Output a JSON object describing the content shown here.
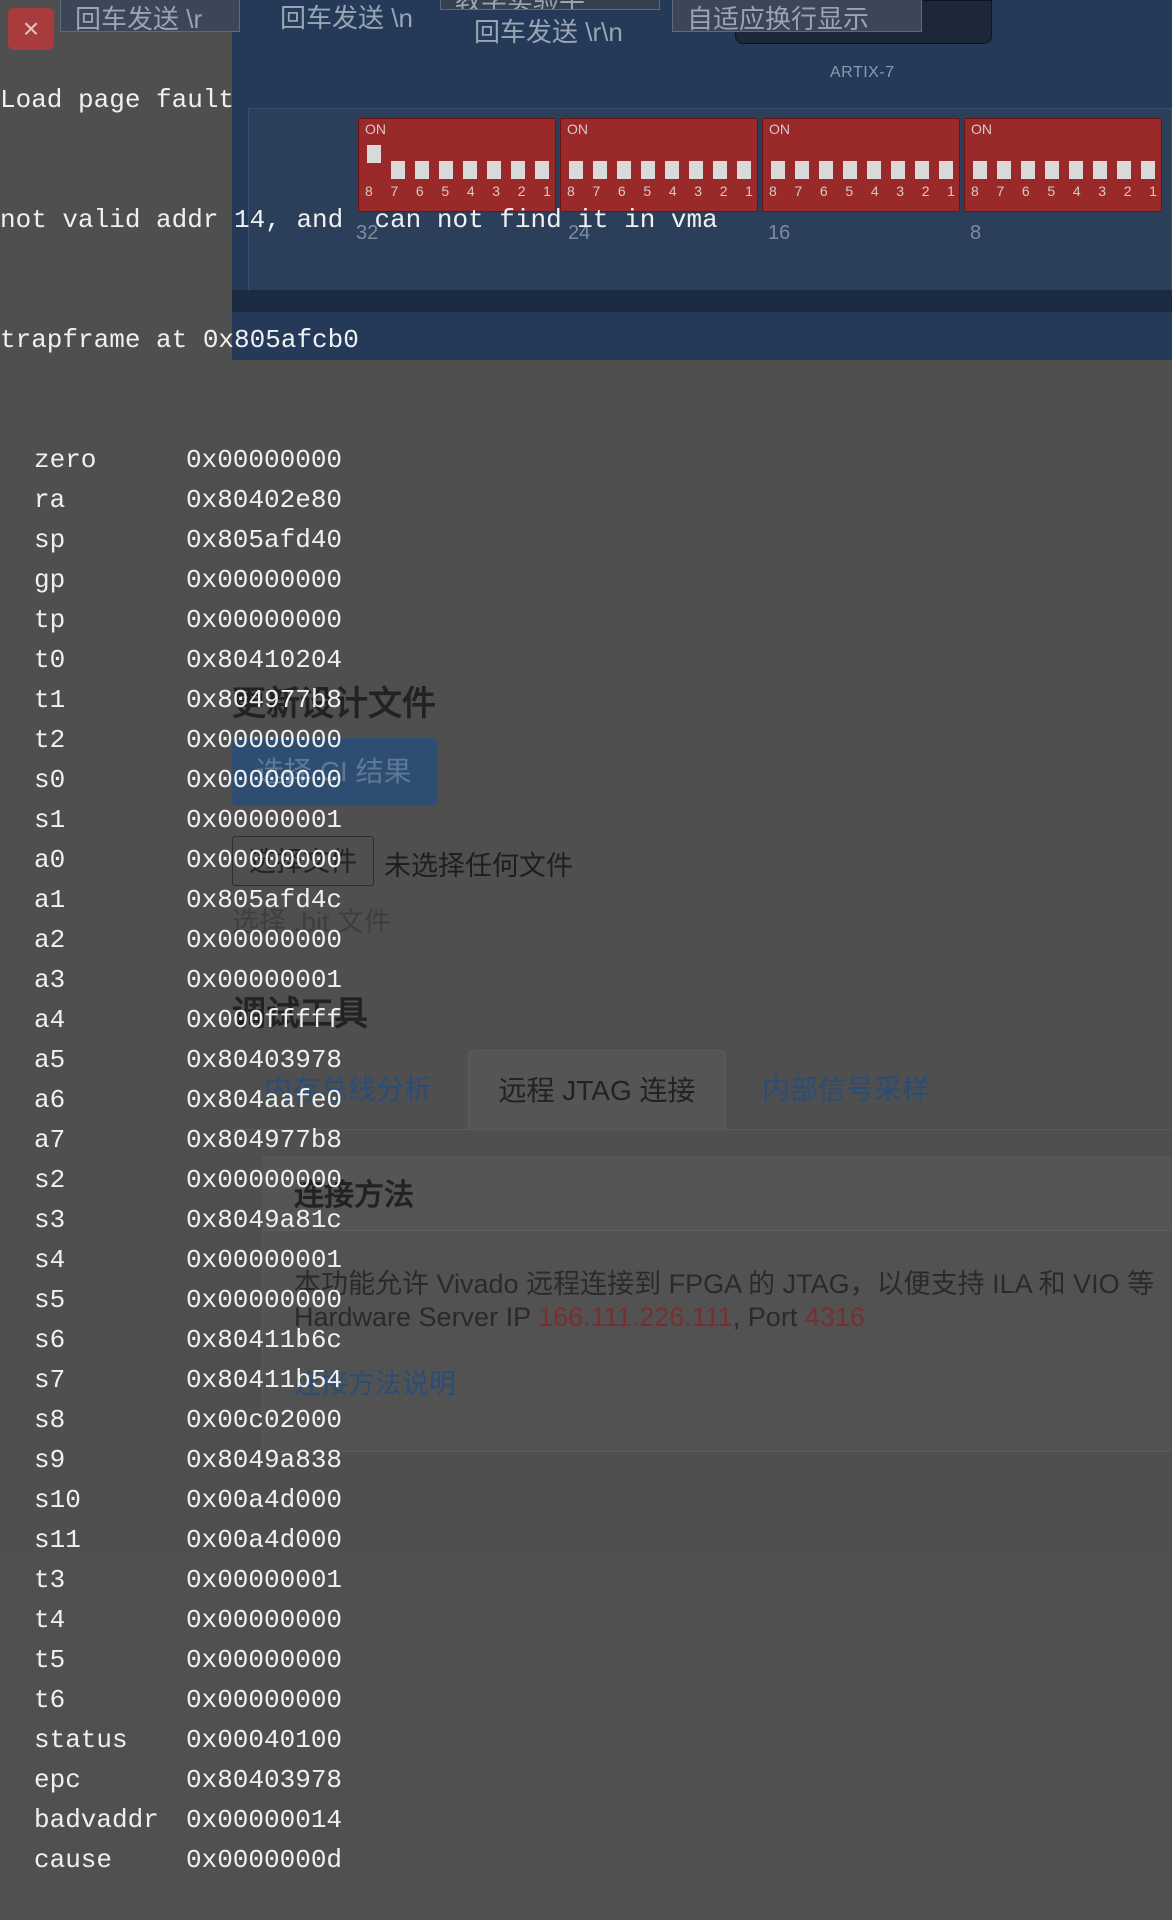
{
  "background": {
    "toolbar_buttons": [
      "回车发送 \\r",
      "回车发送 \\n",
      "回车发送 \\r\\n",
      "自适应换行显示"
    ],
    "toolbar_button_partial": "教学实验平",
    "close_icon": "×",
    "chip_label": "ARTIX-7",
    "dip_on_label": "ON",
    "dip_numbers": [
      "8",
      "7",
      "6",
      "5",
      "4",
      "3",
      "2",
      "1"
    ],
    "dip_indices": [
      "32",
      "24",
      "16",
      "8"
    ],
    "update_heading": "更新设计文件",
    "select_ci_button": "选择 CI 结果",
    "choose_file_button": "选择文件",
    "no_file_chosen": "未选择任何文件",
    "file_hint": "选择 .bit 文件",
    "debug_heading": "调试工具",
    "tabs": [
      "内存总线分析",
      "远程 JTAG 连接",
      "内部信号采样"
    ],
    "connect_heading": "连接方法",
    "connect_desc": "本功能允许 Vivado 远程连接到 FPGA 的 JTAG，以便支持 ILA 和 VIO 等",
    "server_prefix": "Hardware Server IP ",
    "server_ip": "166.111.226.111",
    "server_sep": ", Port ",
    "server_port": "4316",
    "connect_link": "连接方法说明"
  },
  "terminal": {
    "line1": "Load page fault",
    "line2": "not valid addr 14, and  can not find it in vma",
    "line3": "trapframe at 0x805afcb0",
    "registers": [
      {
        "name": "zero",
        "value": "0x00000000"
      },
      {
        "name": "ra",
        "value": "0x80402e80"
      },
      {
        "name": "sp",
        "value": "0x805afd40"
      },
      {
        "name": "gp",
        "value": "0x00000000"
      },
      {
        "name": "tp",
        "value": "0x00000000"
      },
      {
        "name": "t0",
        "value": "0x80410204"
      },
      {
        "name": "t1",
        "value": "0x804977b8"
      },
      {
        "name": "t2",
        "value": "0x00000000"
      },
      {
        "name": "s0",
        "value": "0x00000000"
      },
      {
        "name": "s1",
        "value": "0x00000001"
      },
      {
        "name": "a0",
        "value": "0x00000000"
      },
      {
        "name": "a1",
        "value": "0x805afd4c"
      },
      {
        "name": "a2",
        "value": "0x00000000"
      },
      {
        "name": "a3",
        "value": "0x00000001"
      },
      {
        "name": "a4",
        "value": "0x000fffff"
      },
      {
        "name": "a5",
        "value": "0x80403978"
      },
      {
        "name": "a6",
        "value": "0x804aafe0"
      },
      {
        "name": "a7",
        "value": "0x804977b8"
      },
      {
        "name": "s2",
        "value": "0x00000000"
      },
      {
        "name": "s3",
        "value": "0x8049a81c"
      },
      {
        "name": "s4",
        "value": "0x00000001"
      },
      {
        "name": "s5",
        "value": "0x00000000"
      },
      {
        "name": "s6",
        "value": "0x80411b6c"
      },
      {
        "name": "s7",
        "value": "0x80411b54"
      },
      {
        "name": "s8",
        "value": "0x00c02000"
      },
      {
        "name": "s9",
        "value": "0x8049a838"
      },
      {
        "name": "s10",
        "value": "0x00a4d000"
      },
      {
        "name": "s11",
        "value": "0x00a4d000"
      },
      {
        "name": "t3",
        "value": "0x00000001"
      },
      {
        "name": "t4",
        "value": "0x00000000"
      },
      {
        "name": "t5",
        "value": "0x00000000"
      },
      {
        "name": "t6",
        "value": "0x00000000"
      },
      {
        "name": "status",
        "value": "0x00040100"
      },
      {
        "name": "epc",
        "value": "0x80403978"
      },
      {
        "name": "badvaddr",
        "value": "0x00000014"
      },
      {
        "name": "cause",
        "value": "0x0000000d"
      }
    ]
  }
}
